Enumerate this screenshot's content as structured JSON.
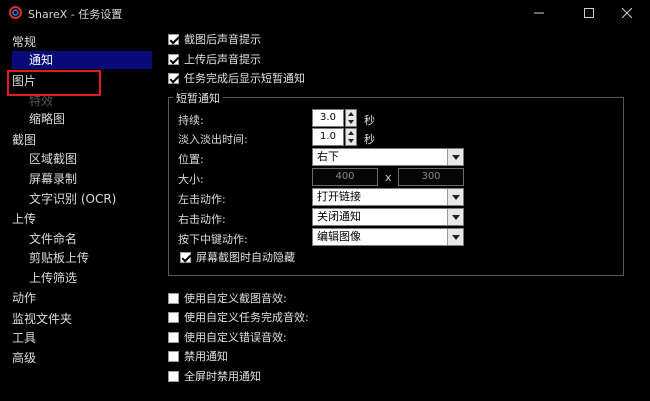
{
  "window": {
    "title": "ShareX - 任务设置",
    "logo_icon": "sharex-logo-icon"
  },
  "sidebar": {
    "items": [
      {
        "label": "常规"
      },
      {
        "label": "通知"
      },
      {
        "label": "图片"
      },
      {
        "label": "特效"
      },
      {
        "label": "缩略图"
      },
      {
        "label": "截图"
      },
      {
        "label": "区域截图"
      },
      {
        "label": "屏幕录制"
      },
      {
        "label": "文字识别 (OCR)"
      },
      {
        "label": "上传"
      },
      {
        "label": "文件命名"
      },
      {
        "label": "剪贴板上传"
      },
      {
        "label": "上传筛选"
      },
      {
        "label": "动作"
      },
      {
        "label": "监视文件夹"
      },
      {
        "label": "工具"
      },
      {
        "label": "高级"
      }
    ]
  },
  "main": {
    "top_checks": [
      {
        "label": "截图后声音提示",
        "checked": true
      },
      {
        "label": "上传后声音提示",
        "checked": true
      },
      {
        "label": "任务完成后显示短暂通知",
        "checked": true
      }
    ],
    "group": {
      "title": "短暂通知",
      "duration_label": "持续:",
      "duration_value": "3.0",
      "duration_unit": "秒",
      "fade_label": "淡入淡出时间:",
      "fade_value": "1.0",
      "fade_unit": "秒",
      "position_label": "位置:",
      "position_value": "右下",
      "size_label": "大小:",
      "size_width": "400",
      "size_times": "x",
      "size_height": "300",
      "left_click_label": "左击动作:",
      "left_click_value": "打开链接",
      "right_click_label": "右击动作:",
      "right_click_value": "关闭通知",
      "middle_click_label": "按下中键动作:",
      "middle_click_value": "编辑图像",
      "auto_hide_label": "屏幕截图时自动隐藏",
      "auto_hide_checked": true
    },
    "bottom_checks": [
      {
        "label": "使用自定义截图音效:",
        "checked": false
      },
      {
        "label": "使用自定义任务完成音效:",
        "checked": false
      },
      {
        "label": "使用自定义错误音效:",
        "checked": false
      },
      {
        "label": "禁用通知",
        "checked": false
      },
      {
        "label": "全屏时禁用通知",
        "checked": false
      }
    ]
  },
  "colors": {
    "accent_selected": "#0a0a7a",
    "highlight_box": "#e21c1c",
    "logo": "#d8342c"
  }
}
